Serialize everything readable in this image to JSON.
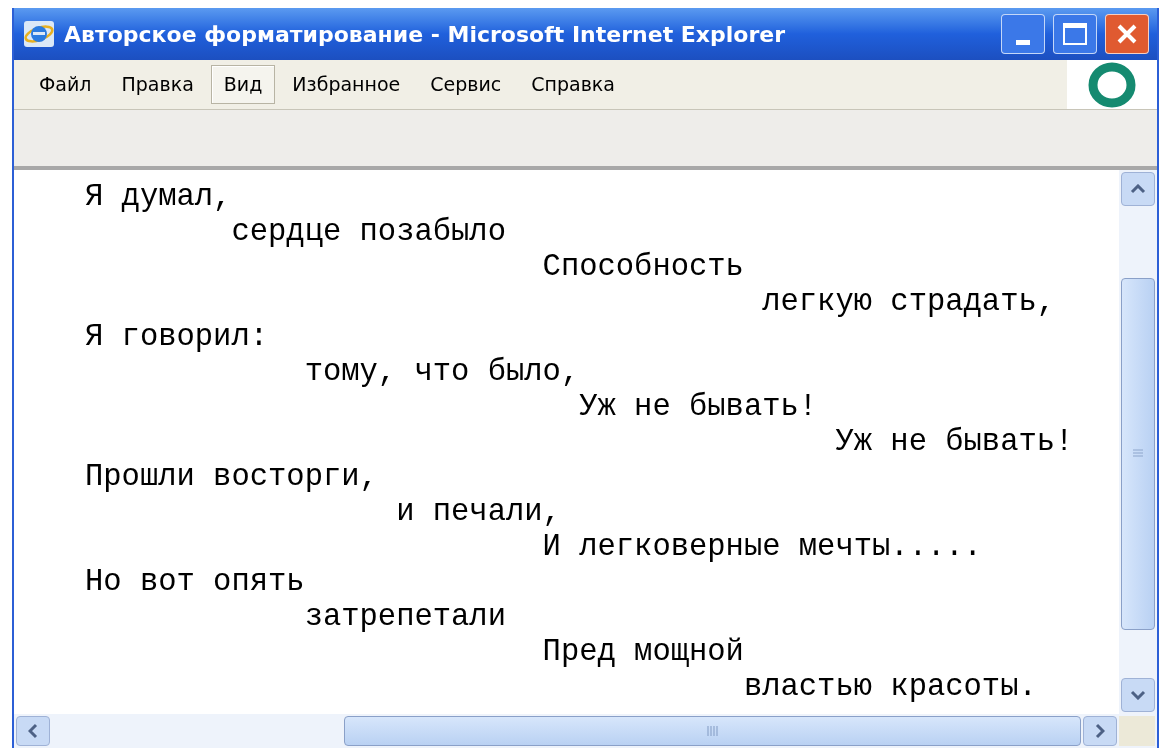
{
  "window": {
    "title": "Авторское форматирование - Microsoft Internet Explorer"
  },
  "menu": [
    {
      "label": "Файл",
      "selected": false
    },
    {
      "label": "Правка",
      "selected": false
    },
    {
      "label": "Вид",
      "selected": true
    },
    {
      "label": "Избранное",
      "selected": false
    },
    {
      "label": "Сервис",
      "selected": false
    },
    {
      "label": "Справка",
      "selected": false
    }
  ],
  "poem_lines": [
    "Я думал,",
    "        сердце позабыло",
    "                         Способность",
    "                                     легкую страдать,",
    "Я говорил:",
    "            тому, что было,",
    "                           Уж не бывать!",
    "                                         Уж не бывать!",
    "Прошли восторги,",
    "                 и печали,",
    "                         И легковерные мечты.....",
    "Но вот опять",
    "            затрепетали",
    "                         Пред мощной",
    "                                    властью красоты."
  ]
}
